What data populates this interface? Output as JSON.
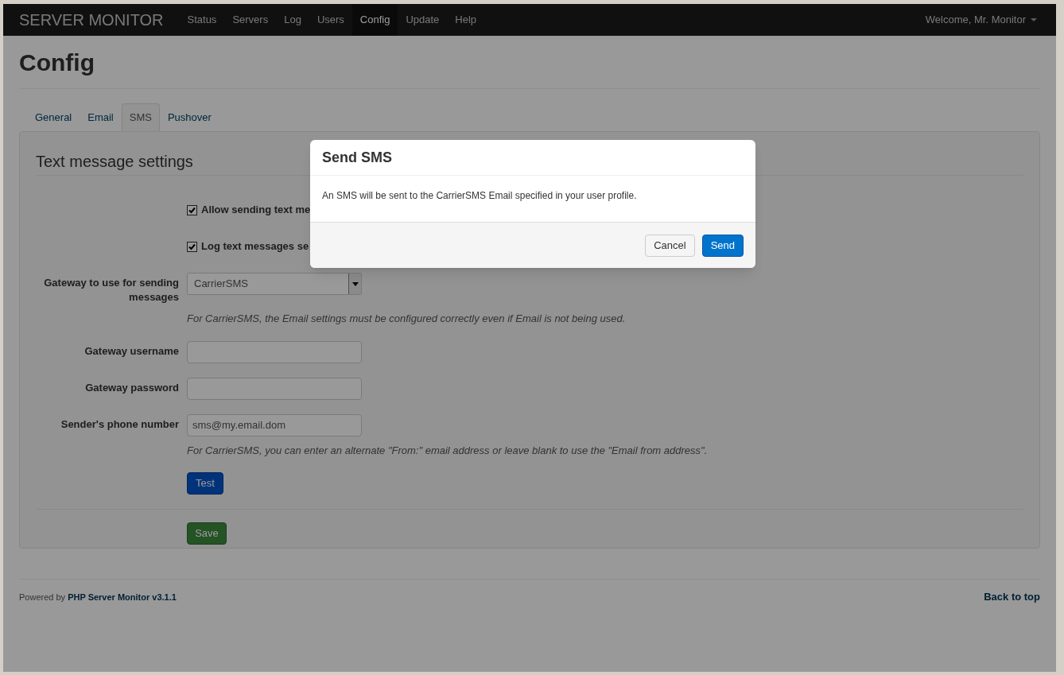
{
  "navbar": {
    "brand": "SERVER MONITOR",
    "items": [
      {
        "label": "Status",
        "selected": false
      },
      {
        "label": "Servers",
        "selected": false
      },
      {
        "label": "Log",
        "selected": false
      },
      {
        "label": "Users",
        "selected": false
      },
      {
        "label": "Config",
        "selected": true
      },
      {
        "label": "Update",
        "selected": false
      },
      {
        "label": "Help",
        "selected": false
      }
    ],
    "user_menu": "Welcome, Mr. Monitor"
  },
  "page_title": "Config",
  "tabs": [
    {
      "label": "General",
      "selected": false
    },
    {
      "label": "Email",
      "selected": false
    },
    {
      "label": "SMS",
      "selected": true
    },
    {
      "label": "Pushover",
      "selected": false
    }
  ],
  "section_title": "Text message settings",
  "checkboxes": [
    {
      "label": "Allow sending text me",
      "checked": true
    },
    {
      "label": "Log text messages se",
      "checked": true
    }
  ],
  "fields": [
    {
      "kind": "select",
      "label": "Gateway to use for sending messages",
      "value": "CarrierSMS",
      "help": "For CarrierSMS, the Email settings must be configured correctly even if Email is not being used."
    },
    {
      "kind": "text",
      "label": "Gateway username"
    },
    {
      "kind": "text",
      "label": "Gateway password"
    },
    {
      "kind": "text",
      "label": "Sender's phone number",
      "placeholder": "sms@my.email.dom",
      "help": "For CarrierSMS, you can enter an alternate \"From:\" email address or leave blank to use the \"Email from address\"."
    }
  ],
  "test_button": "Test",
  "save_button": "Save",
  "footer": {
    "powered_by": "Powered by",
    "link": "PHP Server Monitor v3.1.1",
    "back_to_top": "Back to top"
  },
  "modal": {
    "title": "Send SMS",
    "body": "An SMS will be sent to the CarrierSMS Email specified in your user profile.",
    "buttons": [
      {
        "label": "Cancel",
        "kind": "default"
      },
      {
        "label": "Send",
        "kind": "primary"
      }
    ]
  }
}
